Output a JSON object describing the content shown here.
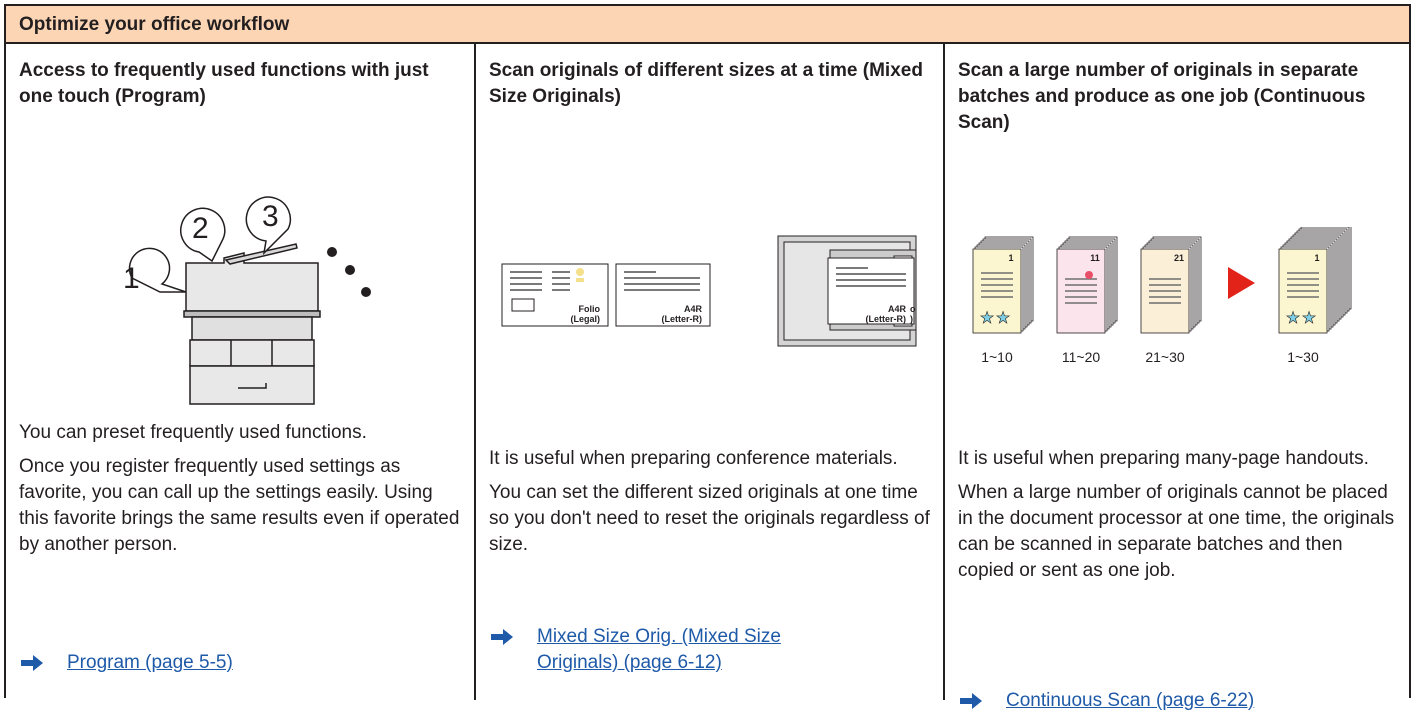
{
  "header": {
    "title": "Optimize your office workflow"
  },
  "columns": [
    {
      "title": "Access to frequently used functions with just one touch (Program)",
      "illustration": {
        "badges": [
          "1",
          "2",
          "3"
        ]
      },
      "paragraphs": [
        "You can preset frequently used functions.",
        "Once you register frequently used settings as favorite, you can call up the settings easily. Using this favorite brings the same results even if operated by another person."
      ],
      "link": "Program (page 5-5)"
    },
    {
      "title": "Scan originals of different sizes at a time (Mixed Size Originals)",
      "illustration": {
        "paper1_line1": "Folio",
        "paper1_line2": "(Legal)",
        "paper2_line1": "A4R",
        "paper2_line2": "(Letter-R)",
        "feeder_line1": "A4R",
        "feeder_line2": "(Letter-R)",
        "feeder_back_line1": "o",
        "feeder_back_line2": ")"
      },
      "paragraphs": [
        "It is useful when preparing conference materials.",
        "You can set the different sized originals at one time so you don't need to reset the originals regardless of size."
      ],
      "link_line1": "Mixed Size Orig. (Mixed Size ",
      "link_line2": "Originals) (page 6-12)"
    },
    {
      "title": "Scan a large number of originals in separate batches and produce as one job (Continuous Scan)",
      "illustration": {
        "stacks": [
          {
            "page": "1",
            "range": "1~10"
          },
          {
            "page": "11",
            "range": "11~20"
          },
          {
            "page": "21",
            "range": "21~30"
          }
        ],
        "result": {
          "page": "1",
          "range": "1~30"
        }
      },
      "paragraphs": [
        "It is useful when preparing many-page handouts.",
        "When a large number of originals cannot be placed in the document processor at one time, the originals can be scanned in separate batches and then copied or sent as one job."
      ],
      "link": "Continuous Scan (page 6-22)"
    }
  ]
}
